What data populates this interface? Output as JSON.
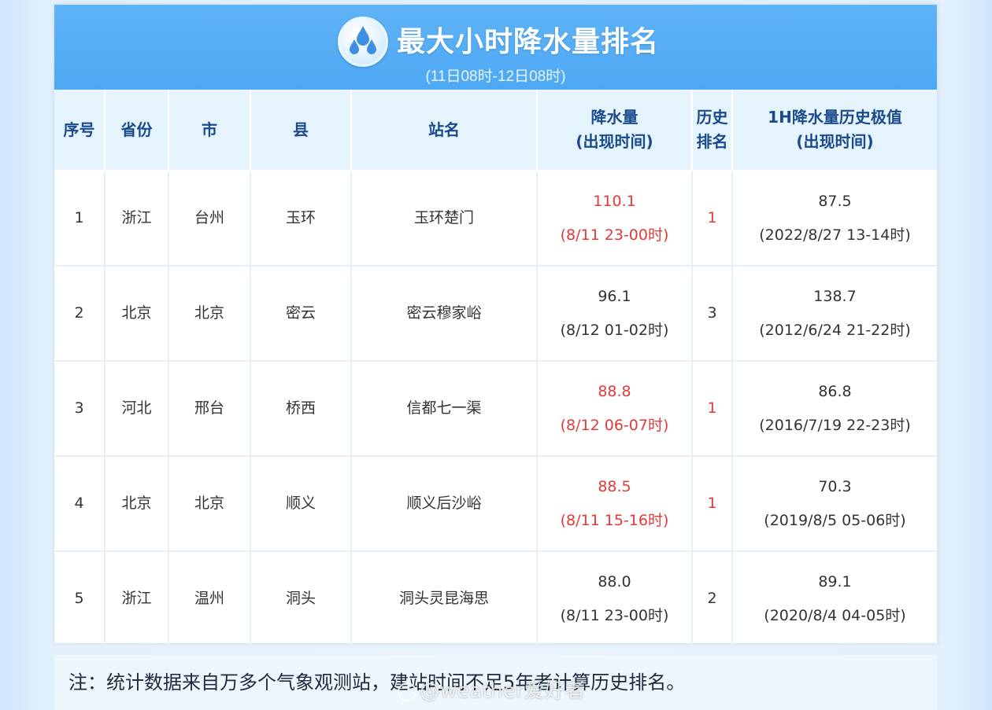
{
  "header": {
    "title": "最大小时降水量排名",
    "subtitle": "(11日08时-12日08时)",
    "logo_icon": "raindrops-icon"
  },
  "table": {
    "columns": {
      "index": "序号",
      "province": "省份",
      "city": "市",
      "county": "县",
      "station": "站名",
      "rain_line1": "降水量",
      "rain_line2": "(出现时间)",
      "rank_line1": "历史",
      "rank_line2": "排名",
      "record_line1": "1H降水量历史极值",
      "record_line2": "(出现时间)"
    },
    "rows": [
      {
        "index": "1",
        "province": "浙江",
        "city": "台州",
        "county": "玉环",
        "station": "玉环楚门",
        "rain": "110.1",
        "rain_time": "(8/11 23-00时)",
        "rank": "1",
        "record": "87.5",
        "record_time": "(2022/8/27 13-14时)",
        "highlight": true
      },
      {
        "index": "2",
        "province": "北京",
        "city": "北京",
        "county": "密云",
        "station": "密云穆家峪",
        "rain": "96.1",
        "rain_time": "(8/12 01-02时)",
        "rank": "3",
        "record": "138.7",
        "record_time": "(2012/6/24 21-22时)",
        "highlight": false
      },
      {
        "index": "3",
        "province": "河北",
        "city": "邢台",
        "county": "桥西",
        "station": "信都七一渠",
        "rain": "88.8",
        "rain_time": "(8/12 06-07时)",
        "rank": "1",
        "record": "86.8",
        "record_time": "(2016/7/19 22-23时)",
        "highlight": true
      },
      {
        "index": "4",
        "province": "北京",
        "city": "北京",
        "county": "顺义",
        "station": "顺义后沙峪",
        "rain": "88.5",
        "rain_time": "(8/11 15-16时)",
        "rank": "1",
        "record": "70.3",
        "record_time": "(2019/8/5 05-06时)",
        "highlight": true
      },
      {
        "index": "5",
        "province": "浙江",
        "city": "温州",
        "county": "洞头",
        "station": "洞头灵昆海思",
        "rain": "88.0",
        "rain_time": "(8/11 23-00时)",
        "rank": "2",
        "record": "89.1",
        "record_time": "(2020/8/4 04-05时)",
        "highlight": false
      }
    ]
  },
  "note": "注：统计数据来自万多个气象观测站，建站时间不足5年者计算历史排名。",
  "watermark": "@weather爱好者",
  "colors": {
    "header_blue": "#4ea8f3",
    "column_header_bg": "#e4f3fc",
    "column_header_text": "#1a4a8c",
    "highlight_red": "#e23a3a"
  }
}
